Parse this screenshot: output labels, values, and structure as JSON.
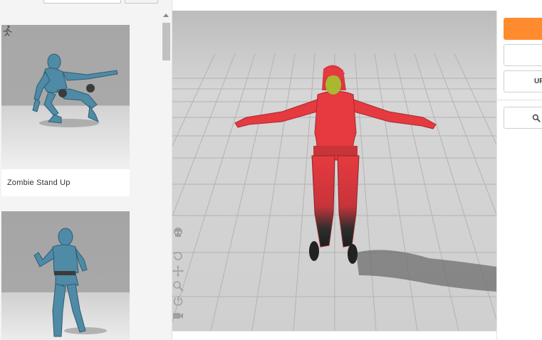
{
  "search": {
    "value": "",
    "button_label": ""
  },
  "animations": [
    {
      "label": "Zombie Stand Up",
      "icon": "running-figure-icon"
    },
    {
      "label": "",
      "icon": ""
    }
  ],
  "viewport": {
    "tools": [
      "skull-icon",
      "rotate-icon",
      "move-icon",
      "zoom-icon",
      "power-icon",
      "camera-icon"
    ]
  },
  "right_panel": {
    "primary_button_label": "",
    "secondary_button_label": "",
    "third_button_label": "UF",
    "search_icon": "search-icon"
  },
  "colors": {
    "accent": "#ff8b2f",
    "character": "#e53a3f",
    "viewport_floor": "#cfcfcf"
  }
}
